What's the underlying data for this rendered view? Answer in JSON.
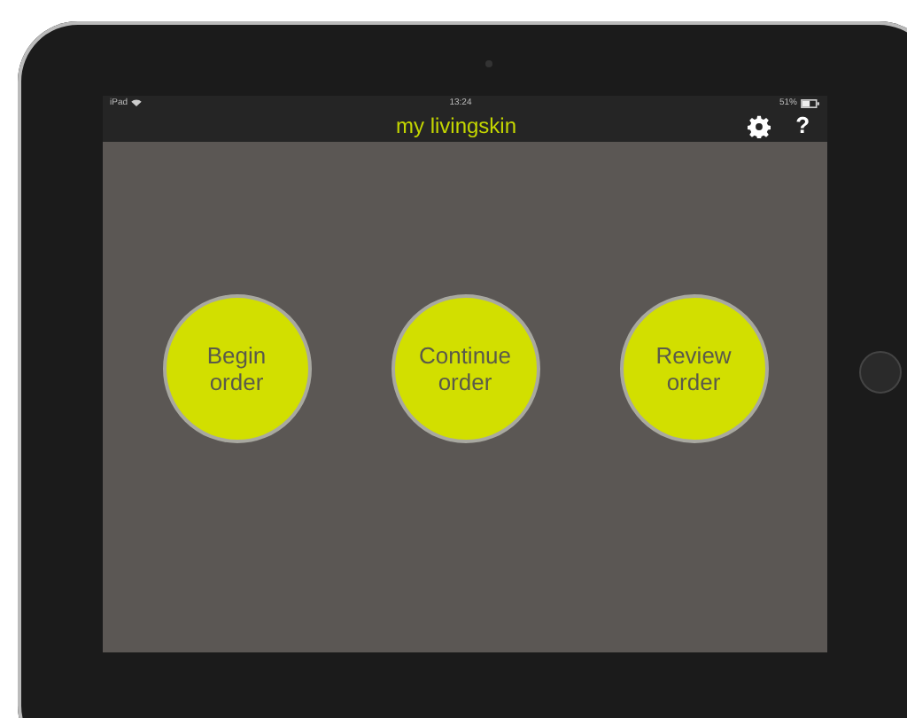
{
  "status_bar": {
    "carrier": "iPad",
    "time": "13:24",
    "battery": "51%"
  },
  "nav_bar": {
    "title": "my livingskin",
    "help": "?"
  },
  "actions": [
    {
      "label": "Begin\norder"
    },
    {
      "label": "Continue\norder"
    },
    {
      "label": "Review\norder"
    }
  ]
}
